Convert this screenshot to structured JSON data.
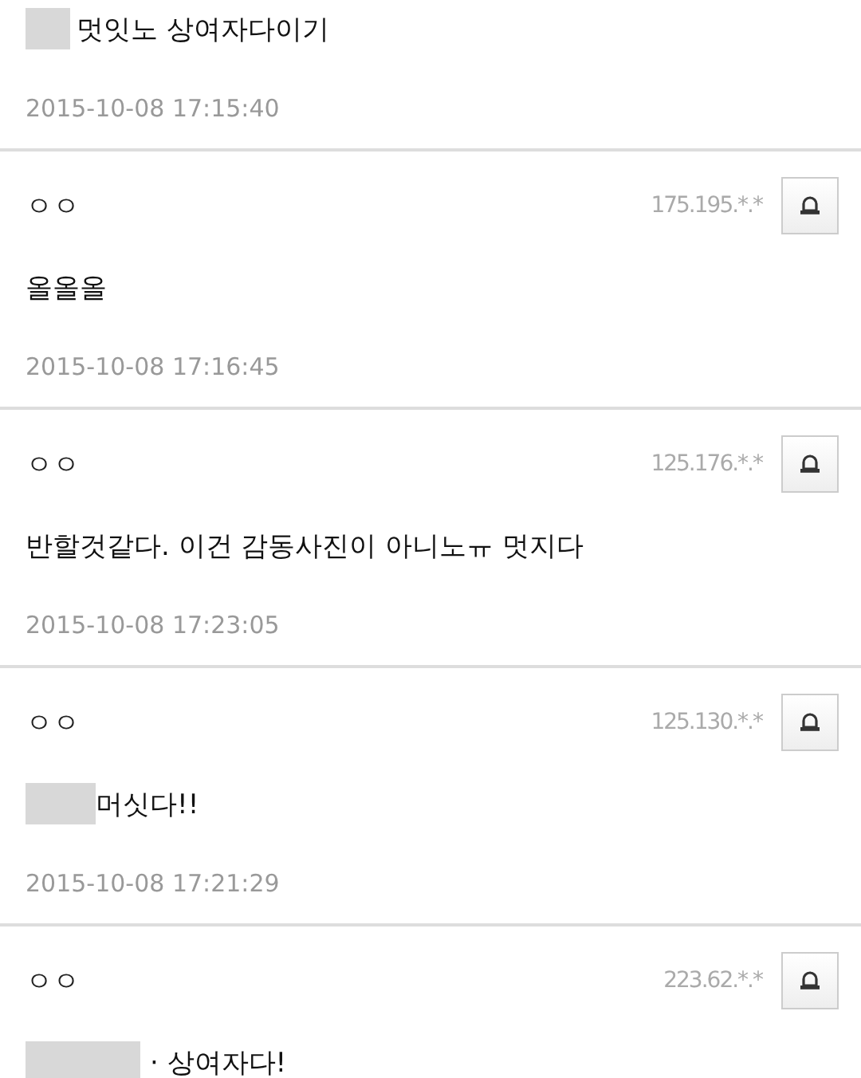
{
  "comments": [
    {
      "redacted_prefix": true,
      "text": "멋잇노 상여자다이기",
      "date": "2015-10-08 17:15:40"
    },
    {
      "author": "ㅇㅇ",
      "ip": "175.195.*.*",
      "redacted_prefix": false,
      "text": "올올올",
      "date": "2015-10-08 17:16:45"
    },
    {
      "author": "ㅇㅇ",
      "ip": "125.176.*.*",
      "redacted_prefix": false,
      "text": "반할것같다. 이건 감동사진이 아니노ㅠ 멋지다",
      "date": "2015-10-08 17:23:05"
    },
    {
      "author": "ㅇㅇ",
      "ip": "125.130.*.*",
      "redacted_prefix": true,
      "text": "머싯다!!",
      "date": "2015-10-08 17:21:29"
    },
    {
      "author": "ㅇㅇ",
      "ip": "223.62.*.*",
      "redacted_prefix": true,
      "text": "· 상여자다!"
    }
  ]
}
